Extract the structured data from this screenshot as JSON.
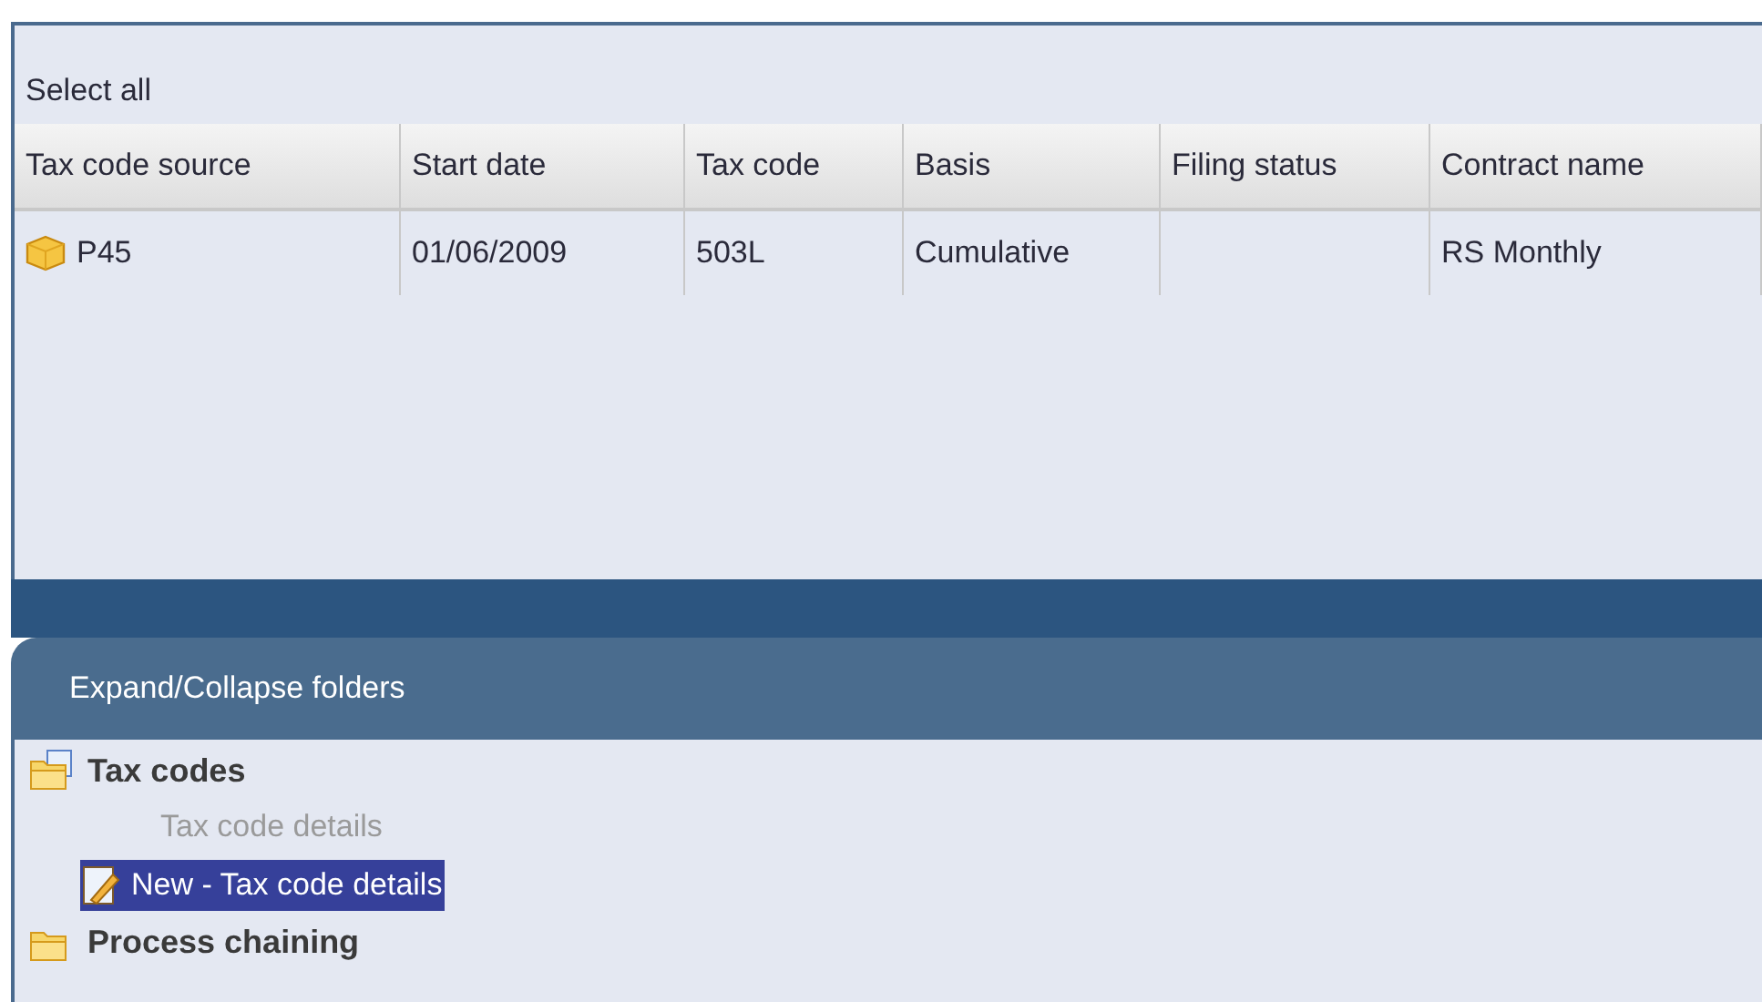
{
  "toolbar": {
    "select_all": "Select all"
  },
  "table": {
    "columns": [
      "Tax code source",
      "Start date",
      "Tax code",
      "Basis",
      "Filing status",
      "Contract name"
    ],
    "rows": [
      {
        "cells": [
          "P45",
          "01/06/2009",
          "503L",
          "Cumulative",
          "",
          "RS Monthly"
        ],
        "selected": false
      }
    ]
  },
  "folders_panel": {
    "title": "Expand/Collapse folders",
    "tree": [
      {
        "label": "Tax codes",
        "kind": "folder",
        "children": [
          {
            "label": "Tax code details",
            "kind": "item",
            "disabled": true,
            "selected": false
          },
          {
            "label": "New - Tax code details",
            "kind": "edit",
            "disabled": false,
            "selected": true
          }
        ]
      },
      {
        "label": "Process chaining",
        "kind": "folder"
      }
    ]
  }
}
